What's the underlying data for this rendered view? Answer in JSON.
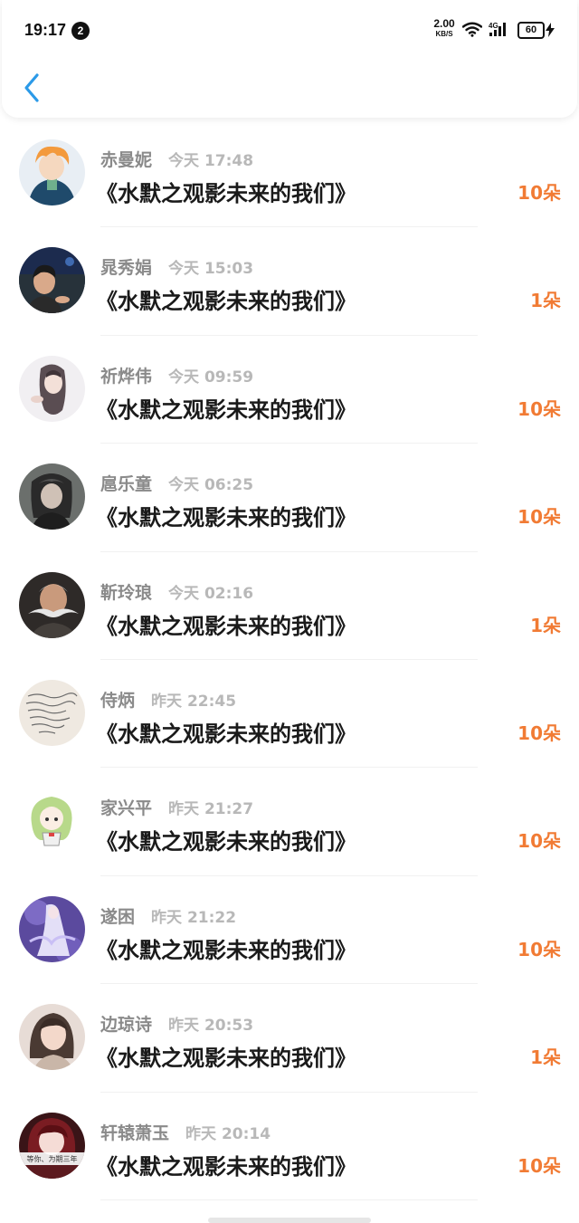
{
  "status_bar": {
    "time": "19:17",
    "notification_count": "2",
    "net_speed_value": "2.00",
    "net_speed_unit": "KB/S",
    "network_type": "4G",
    "battery": "60"
  },
  "header": {
    "back_icon": "chevron-left-icon",
    "accent_color": "#2b9ae8"
  },
  "colors": {
    "amount": "#f17b34",
    "name": "#8a8a8a",
    "meta": "#b8b8b8"
  },
  "records": [
    {
      "name": "赤曼妮",
      "day": "今天",
      "time": "17:48",
      "title": "《水默之观影未来的我们》",
      "amount": "10朵",
      "avatar": "orange-hair-boy-avatar"
    },
    {
      "name": "晁秀娟",
      "day": "今天",
      "time": "15:03",
      "title": "《水默之观影未来的我们》",
      "amount": "1朵",
      "avatar": "night-portrait-avatar"
    },
    {
      "name": "祈烨伟",
      "day": "今天",
      "time": "09:59",
      "title": "《水默之观影未来的我们》",
      "amount": "10朵",
      "avatar": "girl-illustration-avatar"
    },
    {
      "name": "扈乐童",
      "day": "今天",
      "time": "06:25",
      "title": "《水默之观影未来的我们》",
      "amount": "10朵",
      "avatar": "braided-hair-avatar"
    },
    {
      "name": "靳玲琅",
      "day": "今天",
      "time": "02:16",
      "title": "《水默之观影未来的我们》",
      "amount": "1朵",
      "avatar": "mustache-man-avatar"
    },
    {
      "name": "侍炳",
      "day": "昨天",
      "time": "22:45",
      "title": "《水默之观影未来的我们》",
      "amount": "10朵",
      "avatar": "handwriting-note-avatar"
    },
    {
      "name": "家兴平",
      "day": "昨天",
      "time": "21:27",
      "title": "《水默之观影未来的我们》",
      "amount": "10朵",
      "avatar": "green-hair-chibi-avatar"
    },
    {
      "name": "遂困",
      "day": "昨天",
      "time": "21:22",
      "title": "《水默之观影未来的我们》",
      "amount": "10朵",
      "avatar": "purple-fairy-avatar"
    },
    {
      "name": "边琼诗",
      "day": "昨天",
      "time": "20:53",
      "title": "《水默之观影未来的我们》",
      "amount": "1朵",
      "avatar": "girl-selfie-avatar"
    },
    {
      "name": "轩辕萧玉",
      "day": "昨天",
      "time": "20:14",
      "title": "《水默之观影未来的我们》",
      "amount": "10朵",
      "avatar": "red-doll-avatar"
    }
  ],
  "avatar_caption": "等你、为期三年"
}
